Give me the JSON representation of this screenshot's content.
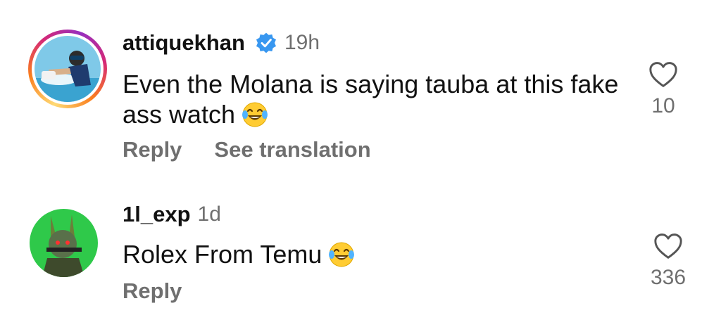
{
  "comments": [
    {
      "username": "attiquekhan",
      "verified": true,
      "time": "19h",
      "text": "Even the Molana is saying tauba at this fake ass watch",
      "emoji": "laughing-tears-emoji",
      "actions": [
        "Reply",
        "See translation"
      ],
      "likes": "10"
    },
    {
      "username": "1l_exp",
      "verified": false,
      "time": "1d",
      "text": "Rolex From Temu",
      "emoji": "laughing-tears-emoji",
      "actions": [
        "Reply"
      ],
      "likes": "336"
    }
  ],
  "colors": {
    "verified_blue": "#3897f0",
    "muted": "#6f6f6f",
    "story_ring": [
      "#feda75",
      "#fa7e1e",
      "#d62976",
      "#962fbf"
    ]
  }
}
